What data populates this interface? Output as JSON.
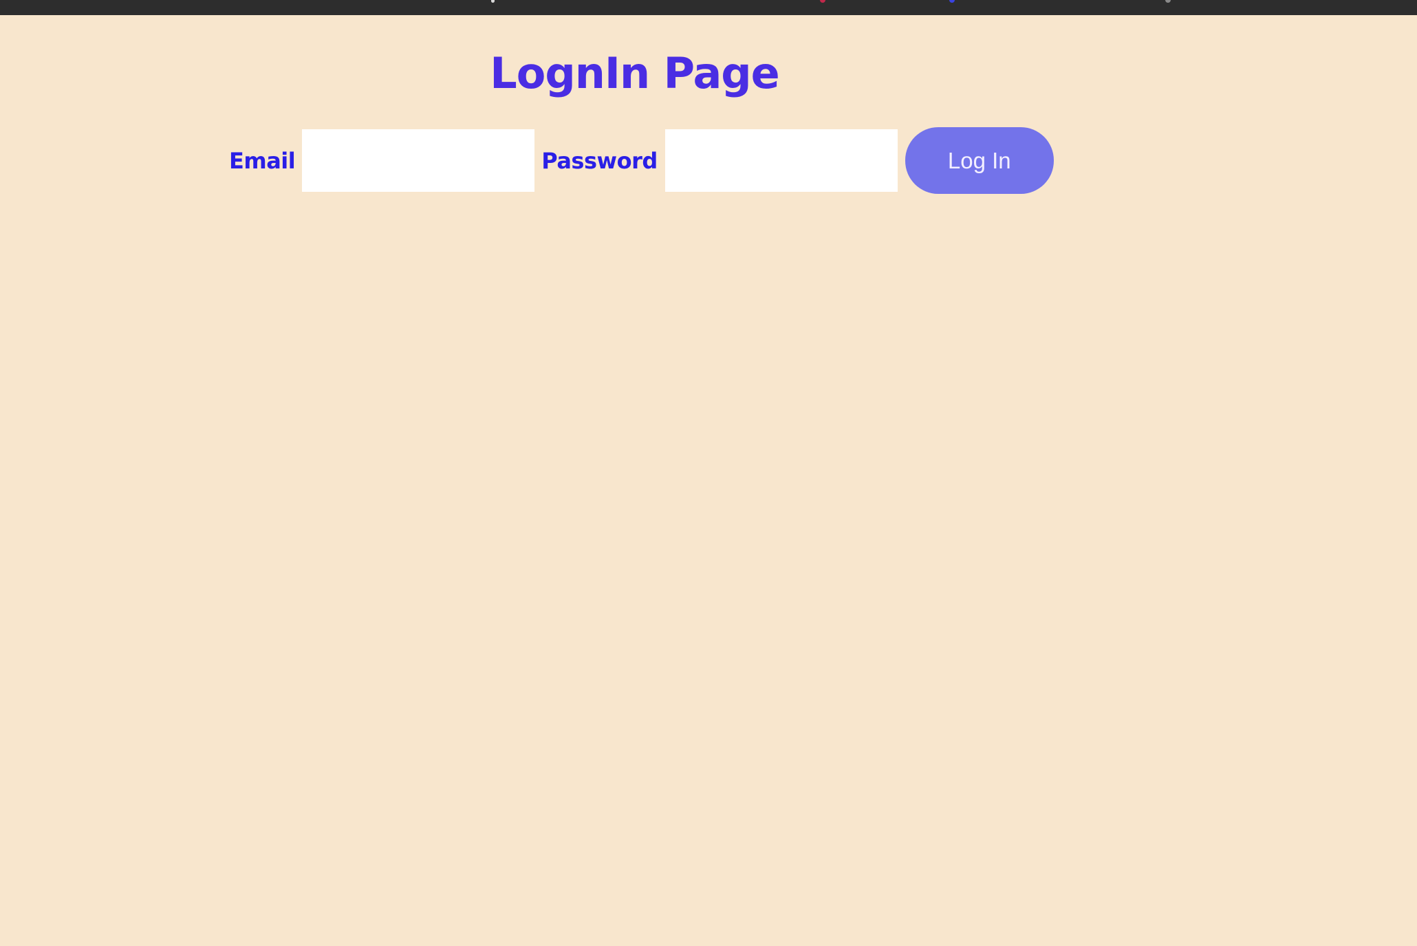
{
  "page": {
    "title": "LognIn Page",
    "background_color": "#f8e6cd",
    "title_color": "#4a2de3"
  },
  "form": {
    "email_label": "Email",
    "email_value": "",
    "email_placeholder": "",
    "password_label": "Password",
    "password_value": "",
    "password_placeholder": "",
    "submit_label": "Log In",
    "label_color": "#2a1fe6",
    "button_color": "#7373ea"
  }
}
